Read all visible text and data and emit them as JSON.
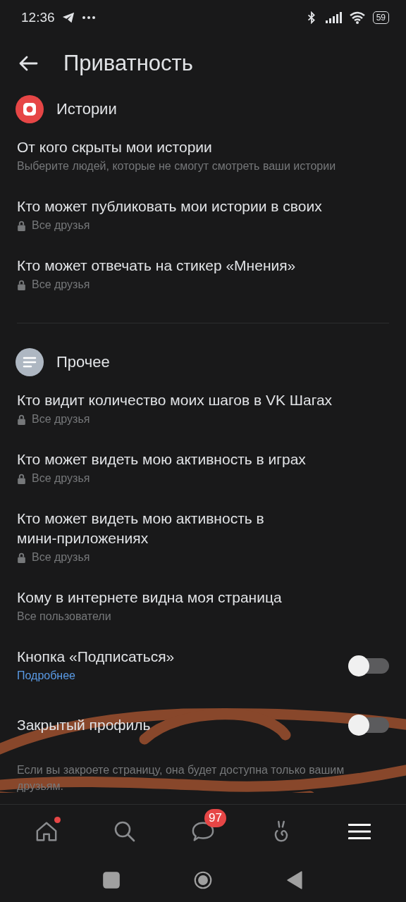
{
  "status_bar": {
    "time": "12:36",
    "battery": "59"
  },
  "header": {
    "title": "Приватность"
  },
  "sections": [
    {
      "title": "Истории",
      "kind": "stories",
      "items": [
        {
          "kind": "text",
          "title": "От кого скрыты мои истории",
          "subtitle": "Выберите людей, которые не смогут смотреть ваши истории",
          "locked": false
        },
        {
          "kind": "text",
          "title": "Кто может публиковать мои истории в своих",
          "subtitle": "Все друзья",
          "locked": true
        },
        {
          "kind": "text",
          "title": "Кто может отвечать на стикер «Мнения»",
          "subtitle": "Все друзья",
          "locked": true
        }
      ]
    },
    {
      "title": "Прочее",
      "kind": "other",
      "items": [
        {
          "kind": "text",
          "title": "Кто видит количество моих шагов в VK Шагах",
          "subtitle": "Все друзья",
          "locked": true
        },
        {
          "kind": "text",
          "title": "Кто может видеть мою активность в играх",
          "subtitle": "Все друзья",
          "locked": true
        },
        {
          "kind": "text",
          "title": "Кто может видеть мою активность в мини-приложениях",
          "subtitle": "Все друзья",
          "locked": true
        },
        {
          "kind": "text",
          "title": "Кому в интернете видна моя страница",
          "subtitle": "Все пользователи",
          "locked": false
        },
        {
          "kind": "toggle",
          "title": "Кнопка «Подписаться»",
          "link": "Подробнее",
          "on": false
        },
        {
          "kind": "toggle",
          "title": "Закрытый профиль",
          "on": false,
          "note": "Если вы закроете страницу, она будет доступна только вашим друзьям."
        }
      ]
    }
  ],
  "nav": [
    {
      "kind": "home",
      "selected": false,
      "dot": true
    },
    {
      "kind": "search",
      "selected": false
    },
    {
      "kind": "messages",
      "selected": false,
      "badge": "97"
    },
    {
      "kind": "clips",
      "selected": false
    },
    {
      "kind": "menu",
      "selected": true
    }
  ]
}
